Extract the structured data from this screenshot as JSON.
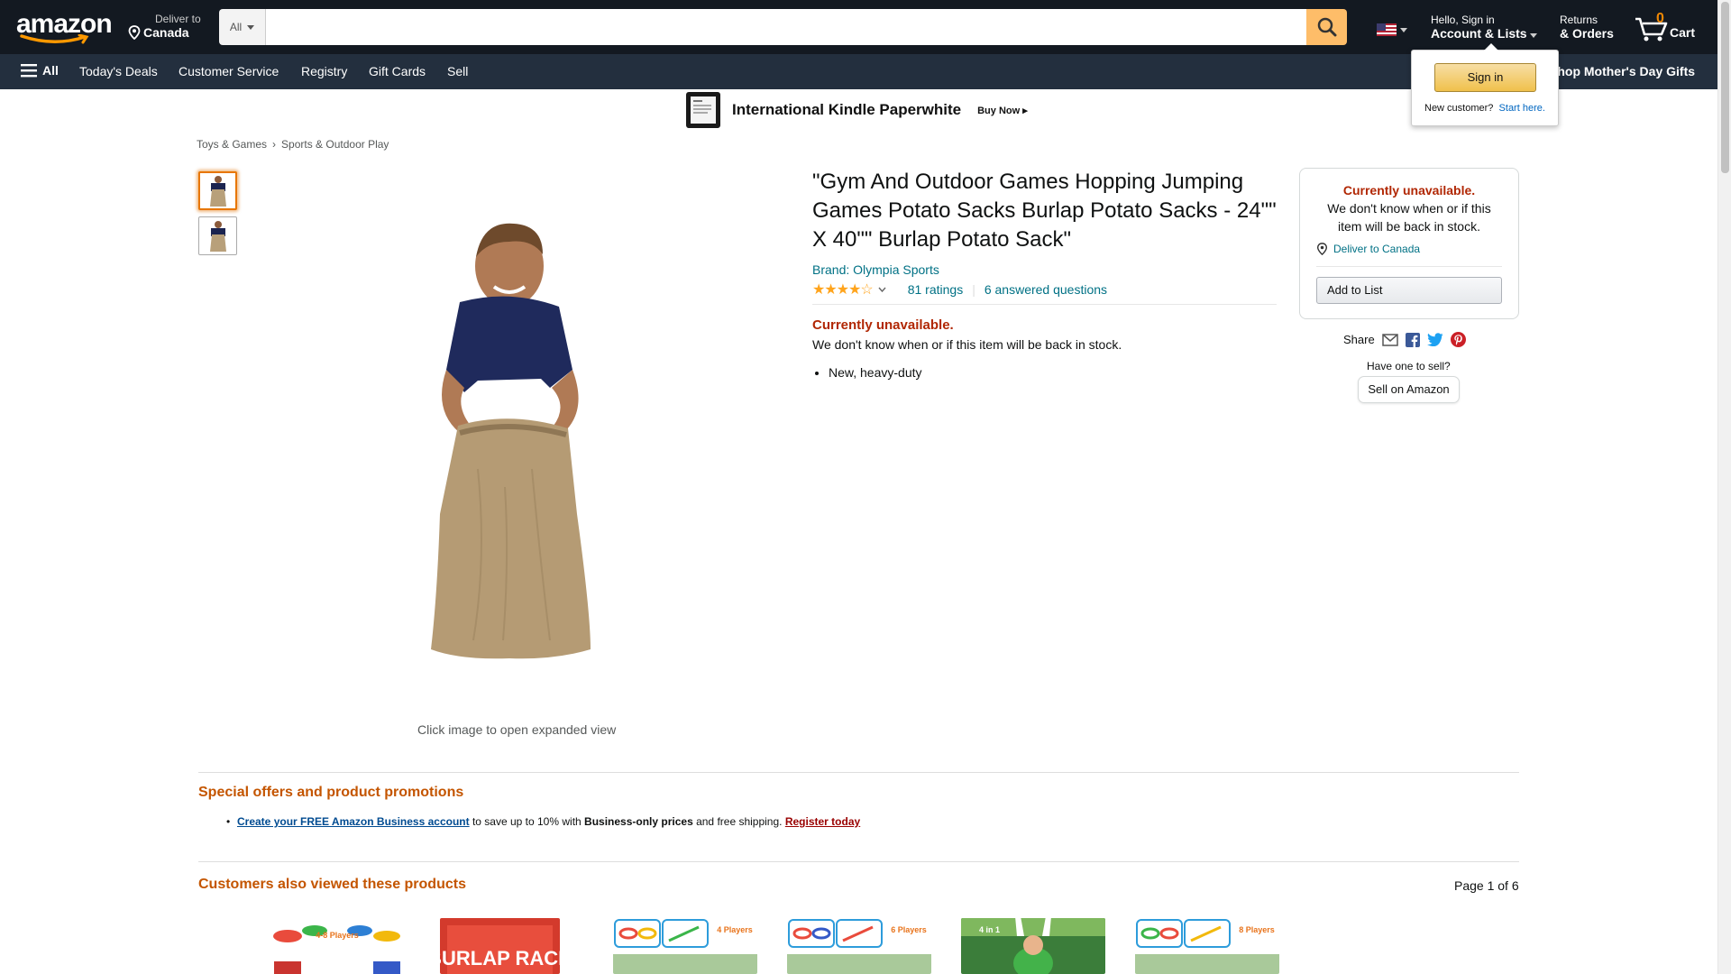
{
  "header": {
    "deliver_line1": "Deliver to",
    "deliver_line2": "Canada",
    "search_category": "All",
    "search_placeholder": "",
    "account_line1": "Hello, Sign in",
    "account_line2": "Account & Lists",
    "returns_line1": "Returns",
    "returns_line2": "& Orders",
    "cart_count": "0",
    "cart_label": "Cart"
  },
  "subnav": {
    "all_label": "All",
    "items": [
      "Today's Deals",
      "Customer Service",
      "Registry",
      "Gift Cards",
      "Sell"
    ],
    "promo": "Shop Mother's Day Gifts"
  },
  "flyout": {
    "signin_label": "Sign in",
    "new_customer": "New customer?",
    "start_here": "Start here."
  },
  "banner": {
    "title": "International Kindle Paperwhite",
    "cta": "Buy Now ▸"
  },
  "breadcrumb": [
    "Toys & Games",
    "Sports & Outdoor Play"
  ],
  "gallery": {
    "caption": "Click image to open expanded view"
  },
  "product": {
    "title": "\"Gym And Outdoor Games Hopping Jumping Games Potato Sacks Burlap Potato Sacks - 24\"\" X 40\"\" Burlap Potato Sack\"",
    "brand": "Brand: Olympia Sports",
    "rating": 4.1,
    "ratings_count": "81 ratings",
    "answered": "6 answered questions",
    "availability": "Currently unavailable.",
    "availability_sub": "We don't know when or if this item will be back in stock.",
    "bullets": [
      "New, heavy-duty"
    ]
  },
  "buybox": {
    "availability": "Currently unavailable.",
    "availability_sub": "We don't know when or if this item will be back in stock.",
    "deliver": "Deliver to Canada",
    "add_to_list": "Add to List",
    "share_label": "Share",
    "have_one": "Have one to sell?",
    "sell_label": "Sell on Amazon"
  },
  "promotions": {
    "title": "Special offers and product promotions",
    "link1": "Create your FREE Amazon Business account",
    "text1": " to save up to 10% with ",
    "bold1": "Business-only prices",
    "text2": " and free shipping. ",
    "link2": "Register today"
  },
  "also_viewed": {
    "title": "Customers also viewed these products",
    "page": "Page 1 of 6",
    "items": [
      {
        "badge": "4-8 Players"
      },
      {
        "badge": "BURLAP RACE"
      },
      {
        "badge": "4 Players"
      },
      {
        "badge": "6 Players"
      },
      {
        "badge": "4 in 1"
      },
      {
        "badge": "8 Players"
      }
    ]
  },
  "colors": {
    "nav_dark": "#131921",
    "nav_secondary": "#232f3e",
    "search_button": "#febd69",
    "link": "#007185",
    "alert": "#b12704",
    "section_title": "#c45500"
  }
}
